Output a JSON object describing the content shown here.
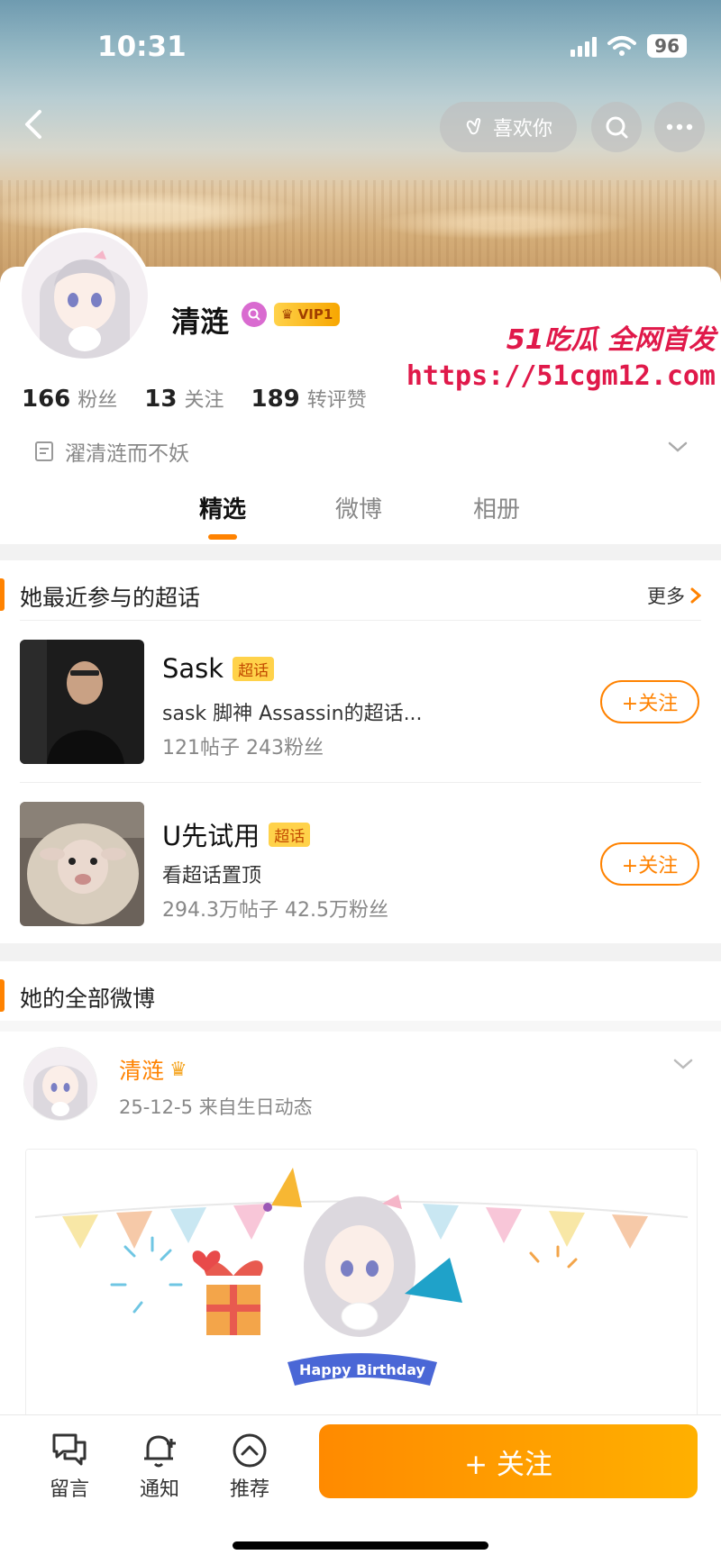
{
  "status": {
    "time": "10:31",
    "battery": "96"
  },
  "header": {
    "like_label": "喜欢你"
  },
  "profile": {
    "name": "清涟",
    "vip_label": "VIP1",
    "stats": [
      {
        "num": "166",
        "label": "粉丝"
      },
      {
        "num": "13",
        "label": "关注"
      },
      {
        "num": "189",
        "label": "转评赞"
      }
    ],
    "bio": "濯清涟而不妖"
  },
  "watermark": {
    "top": "51吃瓜 全网首发",
    "url": "https://51cgm12.com"
  },
  "tabs": [
    {
      "label": "精选",
      "active": true
    },
    {
      "label": "微博",
      "active": false
    },
    {
      "label": "相册",
      "active": false
    }
  ],
  "supertopics": {
    "title": "她最近参与的超话",
    "more_label": "更多",
    "items": [
      {
        "name": "Sask",
        "tag": "超话",
        "desc": "sask 脚神 Assassin的超话...",
        "stats": "121帖子 243粉丝",
        "follow_label": "+关注"
      },
      {
        "name": "U先试用",
        "tag": "超话",
        "desc": "看超话置顶",
        "stats": "294.3万帖子 42.5万粉丝",
        "follow_label": "+关注"
      }
    ]
  },
  "posts": {
    "title": "她的全部微博",
    "post": {
      "author": "清涟",
      "meta": "25-12-5  来自生日动态",
      "image_caption": "Happy Birthday"
    }
  },
  "bottom_bar": {
    "items": [
      {
        "label": "留言",
        "icon": "comment-icon"
      },
      {
        "label": "通知",
        "icon": "bell-plus-icon"
      },
      {
        "label": "推荐",
        "icon": "chevron-up-circle-icon"
      }
    ],
    "follow_label": "+ 关注"
  },
  "colors": {
    "accent": "#ff8200",
    "watermark": "#e0194a",
    "tag_bg": "#ffd24a"
  }
}
